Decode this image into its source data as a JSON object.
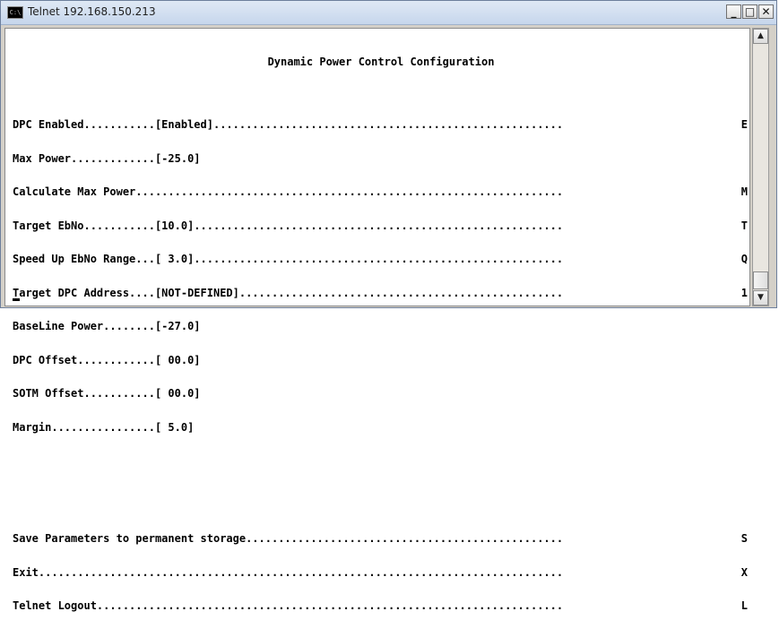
{
  "window": {
    "title": "Telnet 192.168.150.213",
    "icon_label": "C:\\",
    "minimize_glyph": "_",
    "maximize_glyph": "□",
    "close_glyph": "✕"
  },
  "terminal": {
    "heading": "Dynamic Power Control Configuration",
    "rows": [
      {
        "text": "DPC Enabled...........[Enabled]......................................................",
        "key": "E"
      },
      {
        "text": "Max Power.............[-25.0]",
        "key": ""
      },
      {
        "text": "Calculate Max Power..................................................................",
        "key": "M"
      },
      {
        "text": "Target EbNo...........[10.0].........................................................",
        "key": "T"
      },
      {
        "text": "Speed Up EbNo Range...[ 3.0].........................................................",
        "key": "Q"
      },
      {
        "text": "Target DPC Address....[NOT-DEFINED]..................................................",
        "key": "1"
      },
      {
        "text": "BaseLine Power........[-27.0]",
        "key": ""
      },
      {
        "text": "DPC Offset............[ 00.0]",
        "key": ""
      },
      {
        "text": "SOTM Offset...........[ 00.0]",
        "key": ""
      },
      {
        "text": "Margin................[ 5.0]",
        "key": ""
      }
    ],
    "footer_rows": [
      {
        "text": "Save Parameters to permanent storage.................................................",
        "key": "S"
      },
      {
        "text": "Exit.................................................................................",
        "key": "X"
      },
      {
        "text": "Telnet Logout........................................................................",
        "key": "L"
      }
    ]
  },
  "scrollbar": {
    "up_glyph": "▲",
    "down_glyph": "▼"
  }
}
